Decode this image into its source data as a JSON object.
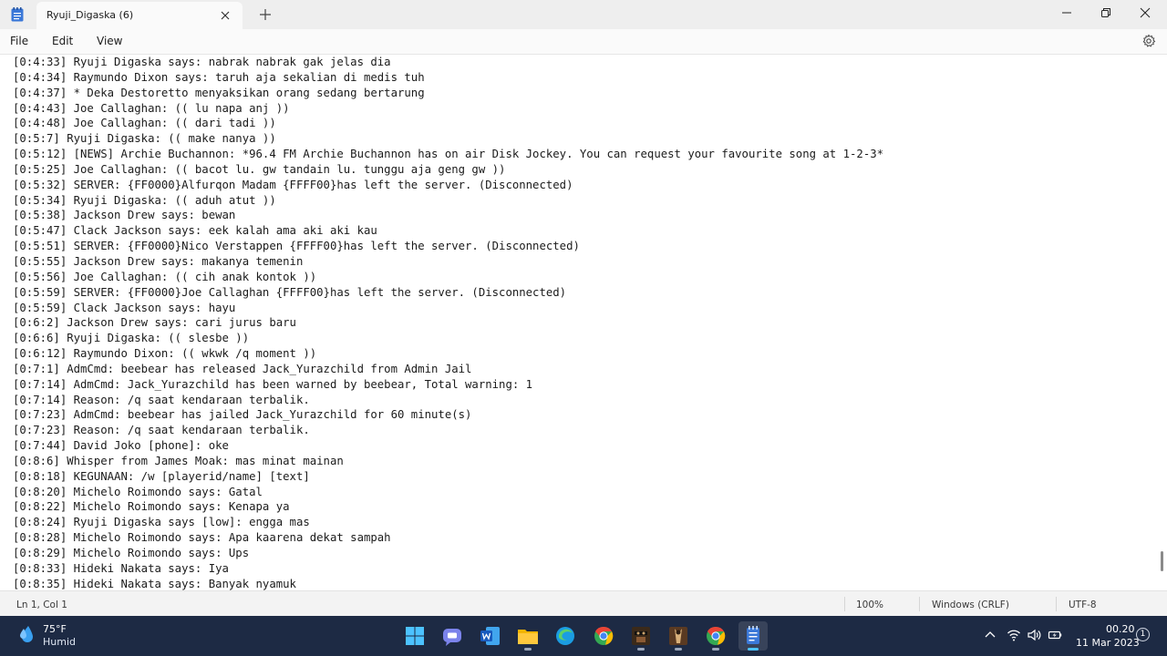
{
  "window": {
    "tab_title": "Ryuji_Digaska (6)"
  },
  "menu": {
    "file": "File",
    "edit": "Edit",
    "view": "View"
  },
  "editor": {
    "lines": [
      "[0:4:33] Ryuji Digaska says: nabrak nabrak gak jelas dia",
      "[0:4:34] Raymundo Dixon says: taruh aja sekalian di medis tuh",
      "[0:4:37] * Deka Destoretto menyaksikan orang sedang bertarung",
      "[0:4:43] Joe Callaghan: (( lu napa anj ))",
      "[0:4:48] Joe Callaghan: (( dari tadi ))",
      "[0:5:7] Ryuji Digaska: (( make nanya ))",
      "[0:5:12] [NEWS] Archie Buchannon: *96.4 FM Archie Buchannon has on air Disk Jockey. You can request your favourite song at 1-2-3*",
      "[0:5:25] Joe Callaghan: (( bacot lu. gw tandain lu. tunggu aja geng gw ))",
      "[0:5:32] SERVER: {FF0000}Alfurqon Madam {FFFF00}has left the server. (Disconnected)",
      "[0:5:34] Ryuji Digaska: (( aduh atut ))",
      "[0:5:38] Jackson Drew says: bewan",
      "[0:5:47] Clack Jackson says: eek kalah ama aki aki kau",
      "[0:5:51] SERVER: {FF0000}Nico Verstappen {FFFF00}has left the server. (Disconnected)",
      "[0:5:55] Jackson Drew says: makanya temenin",
      "[0:5:56] Joe Callaghan: (( cih anak kontok ))",
      "[0:5:59] SERVER: {FF0000}Joe Callaghan {FFFF00}has left the server. (Disconnected)",
      "[0:5:59] Clack Jackson says: hayu",
      "[0:6:2] Jackson Drew says: cari jurus baru",
      "[0:6:6] Ryuji Digaska: (( slesbe ))",
      "[0:6:12] Raymundo Dixon: (( wkwk /q moment ))",
      "[0:7:1] AdmCmd: beebear has released Jack_Yurazchild from Admin Jail",
      "[0:7:14] AdmCmd: Jack_Yurazchild has been warned by beebear, Total warning: 1",
      "[0:7:14] Reason: /q saat kendaraan terbalik.",
      "[0:7:23] AdmCmd: beebear has jailed Jack_Yurazchild for 60 minute(s)",
      "[0:7:23] Reason: /q saat kendaraan terbalik.",
      "[0:7:44] David Joko [phone]: oke",
      "[0:8:6] Whisper from James Moak: mas minat mainan",
      "[0:8:18] KEGUNAAN: /w [playerid/name] [text]",
      "[0:8:20] Michelo Roimondo says: Gatal",
      "[0:8:22] Michelo Roimondo says: Kenapa ya",
      "[0:8:24] Ryuji Digaska says [low]: engga mas",
      "[0:8:28] Michelo Roimondo says: Apa kaarena dekat sampah",
      "[0:8:29] Michelo Roimondo says: Ups",
      "[0:8:33] Hideki Nakata says: Iya",
      "[0:8:35] Hideki Nakata says: Banyak nyamuk"
    ]
  },
  "statusbar": {
    "position": "Ln 1, Col 1",
    "zoom": "100%",
    "line_ending": "Windows (CRLF)",
    "encoding": "UTF-8"
  },
  "taskbar": {
    "weather_temp": "75°F",
    "weather_condition": "Humid",
    "time": "00.20",
    "date": "11 Mar 2023",
    "notification_count": "1"
  },
  "colors": {
    "titlebar": "#eeeeee",
    "taskbar": "#1d2a44",
    "notepad_blue": "#3b78d8",
    "accent": "#4cc2ff"
  }
}
